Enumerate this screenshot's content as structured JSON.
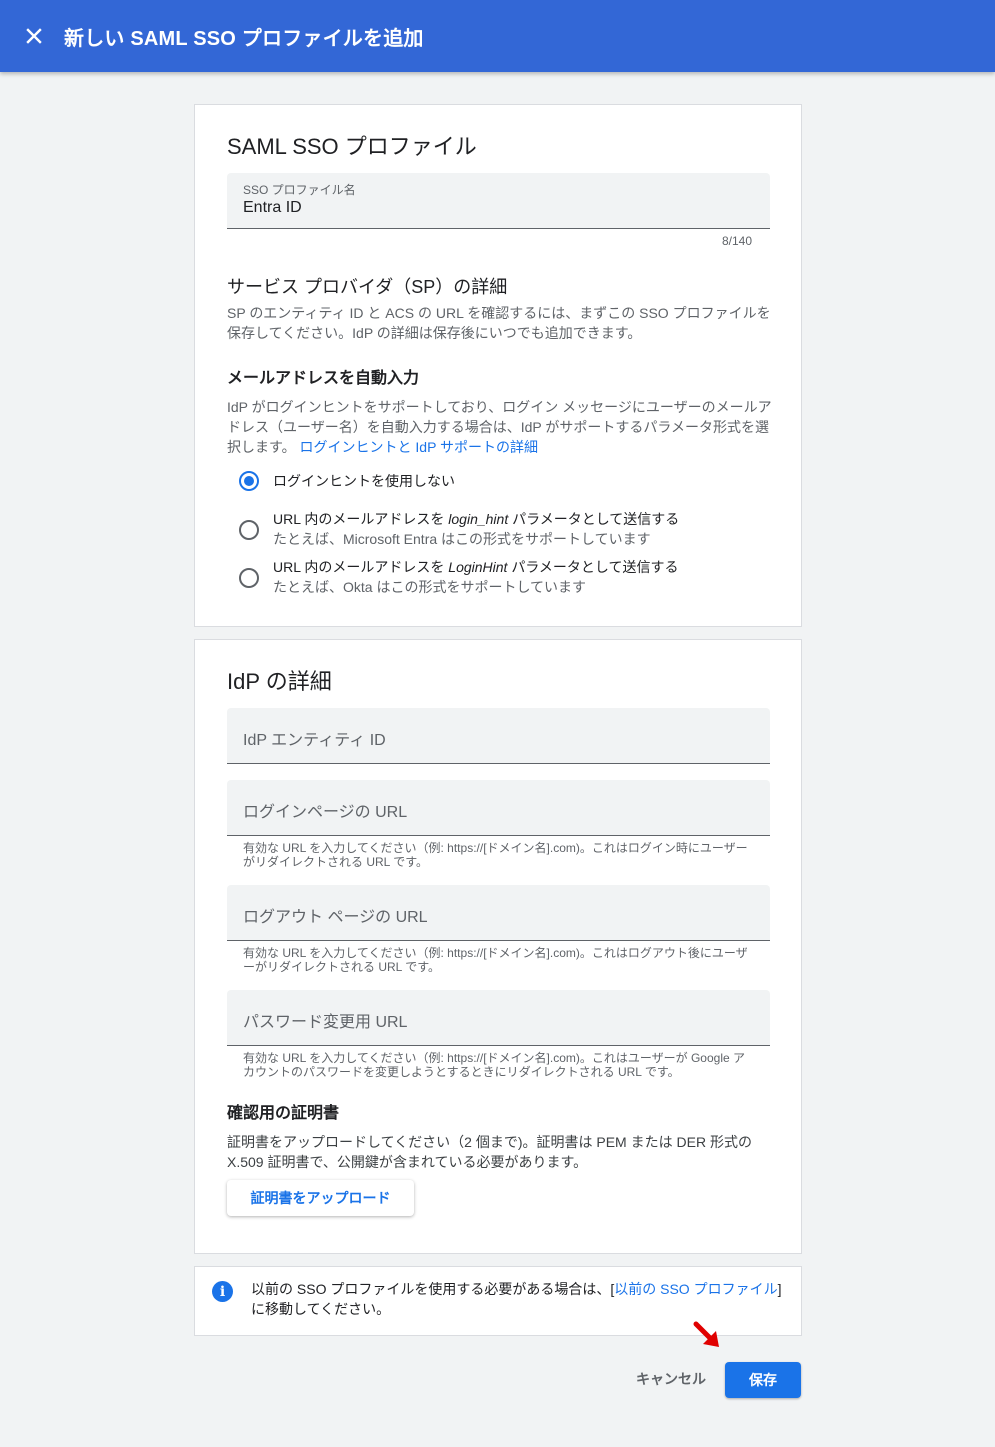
{
  "header": {
    "title": "新しい SAML SSO プロファイルを追加"
  },
  "profile_card": {
    "title": "SAML SSO プロファイル",
    "name_field": {
      "label": "SSO プロファイル名",
      "value": "Entra ID",
      "counter": "8/140"
    },
    "sp_heading": "サービス プロバイダ（SP）の詳細",
    "sp_text": "SP のエンティティ ID と ACS の URL を確認するには、まずこの SSO プロファイルを保存してください。IdP の詳細は保存後にいつでも追加できます。",
    "autofill_heading": "メールアドレスを自動入力",
    "autofill_text": "IdP がログインヒントをサポートしており、ログイン メッセージにユーザーのメールアドレス（ユーザー名）を自動入力する場合は、IdP がサポートするパラメータ形式を選択します。",
    "autofill_link": "ログインヒントと IdP サポートの詳細",
    "options": [
      {
        "label": "ログインヒントを使用しない",
        "checked": true
      },
      {
        "label_pre": "URL 内のメールアドレスを ",
        "label_em": "login_hint",
        "label_post": " パラメータとして送信する",
        "sub": "たとえば、Microsoft Entra はこの形式をサポートしています",
        "checked": false
      },
      {
        "label_pre": "URL 内のメールアドレスを ",
        "label_em": "LoginHint",
        "label_post": " パラメータとして送信する",
        "sub": "たとえば、Okta はこの形式をサポートしています",
        "checked": false
      }
    ]
  },
  "idp_card": {
    "title": "IdP の詳細",
    "entity_id_placeholder": "IdP エンティティ ID",
    "login_url_placeholder": "ログインページの URL",
    "login_url_helper": "有効な URL を入力してください（例: https://[ドメイン名].com)。これはログイン時にユーザーがリダイレクトされる URL です。",
    "logout_url_placeholder": "ログアウト ページの URL",
    "logout_url_helper": "有効な URL を入力してください（例: https://[ドメイン名].com)。これはログアウト後にユーザーがリダイレクトされる URL です。",
    "password_url_placeholder": "パスワード変更用 URL",
    "password_url_helper": "有効な URL を入力してください（例: https://[ドメイン名].com)。これはユーザーが Google アカウントのパスワードを変更しようとするときにリダイレクトされる URL です。",
    "cert_heading": "確認用の証明書",
    "cert_text": "証明書をアップロードしてください（2 個まで)。証明書は PEM または DER 形式の X.509 証明書で、公開鍵が含まれている必要があります。",
    "upload_label": "証明書をアップロード"
  },
  "info_card": {
    "text_pre": "以前の SSO プロファイルを使用する必要がある場合は、[",
    "link": "以前の SSO プロファイル",
    "text_post": "] に移動してください。"
  },
  "actions": {
    "cancel": "キャンセル",
    "save": "保存"
  },
  "colors": {
    "header": "#3367d6",
    "accent": "#1a73e8",
    "annotation_arrow": "#e00000"
  }
}
